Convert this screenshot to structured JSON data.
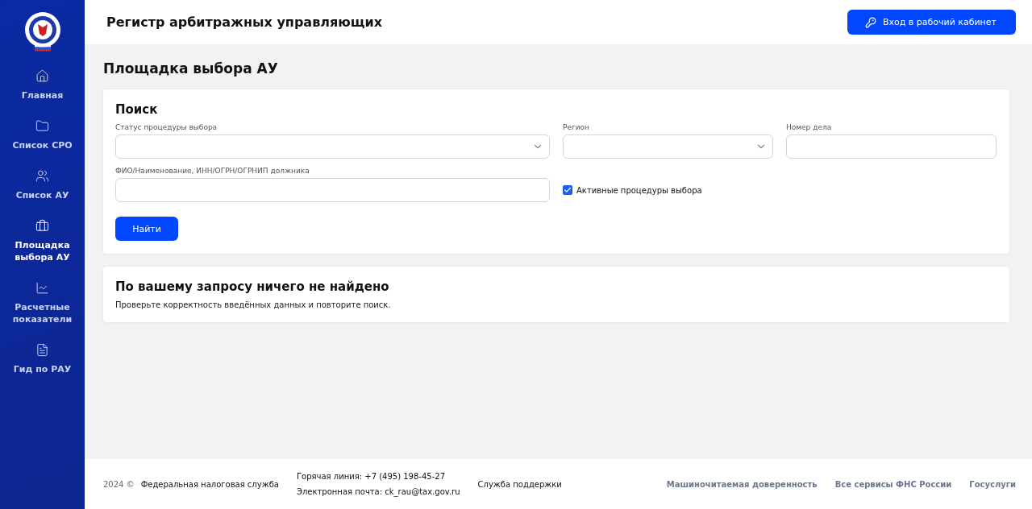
{
  "sidebar": {
    "items": [
      {
        "label": "Главная",
        "kind": "home",
        "selected": false
      },
      {
        "label": "Список СРО",
        "kind": "folder",
        "selected": false
      },
      {
        "label": "Список АУ",
        "kind": "people",
        "selected": false
      },
      {
        "label": "Площадка выбора АУ",
        "kind": "briefcase",
        "selected": true
      },
      {
        "label": "Расчетные показатели",
        "kind": "chart",
        "selected": false
      },
      {
        "label": "Гид по РАУ",
        "kind": "document",
        "selected": false
      }
    ]
  },
  "header": {
    "title": "Регистр арбитражных управляющих",
    "login_button": "Вход в рабочий кабинет"
  },
  "page_title": "Площадка выбора АУ",
  "search": {
    "title": "Поиск",
    "fields": [
      {
        "label": "Статус процедуры выбора",
        "kind": "select"
      },
      {
        "label": "Регион",
        "kind": "select"
      },
      {
        "label": "Номер дела",
        "kind": "text"
      },
      {
        "label": "ФИО/Наименование, ИНН/ОГРН/ОГРНИП должника",
        "kind": "text"
      }
    ],
    "checkbox": {
      "label": "Активные процедуры выбора",
      "checked": true
    },
    "button": "Найти"
  },
  "result": {
    "title": "По вашему запросу ничего не найдено",
    "message": "Проверьте корректность введённых данных и повторите поиск."
  },
  "footer": {
    "year": "2024 ©",
    "org": "Федеральная налоговая служба",
    "hotline": "Горячая линия: +7 (495) 198-45-27",
    "email": "Электронная почта: ck_rau@tax.gov.ru",
    "support": "Служба поддержки",
    "links": [
      "Машиночитаемая доверенность",
      "Все сервисы ФНС России",
      "Госуслуги"
    ]
  }
}
